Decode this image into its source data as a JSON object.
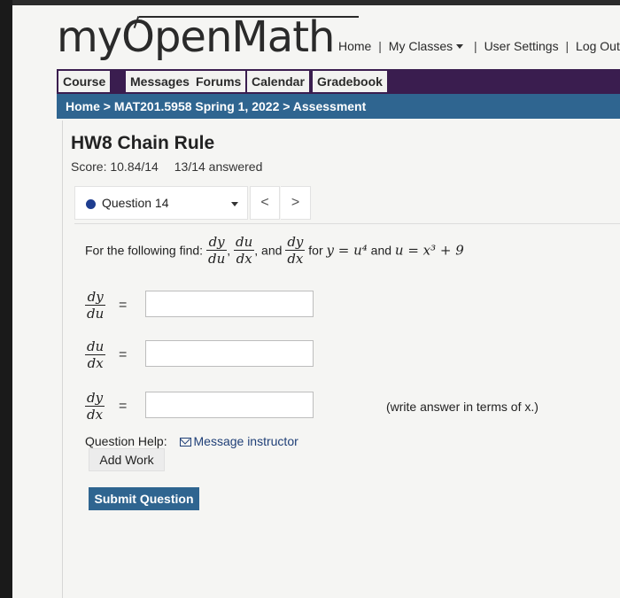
{
  "app": {
    "logo": "myOpenMath"
  },
  "topnav": {
    "home": "Home",
    "my_classes": "My Classes",
    "user_settings": "User Settings",
    "logout": "Log Out",
    "sep": "|"
  },
  "menubar": {
    "items": [
      "Course",
      "Messages",
      "Forums",
      "Calendar",
      "Gradebook"
    ]
  },
  "breadcrumb": {
    "text": "Home > MAT201.5958 Spring 1, 2022 > Assessment"
  },
  "assessment": {
    "title": "HW8 Chain Rule",
    "score": "Score: 10.84/14",
    "answered": "13/14 answered"
  },
  "question_nav": {
    "selected": "Question 14",
    "prev": "<",
    "next": ">"
  },
  "question": {
    "prompt_prefix": "For the following find:",
    "frac1_num": "dy",
    "frac1_den": "du",
    "comma": ",",
    "frac2_num": "du",
    "frac2_den": "dx",
    "and": ", and",
    "frac3_num": "dy",
    "frac3_den": "dx",
    "for_text": "for",
    "eq1": "y = u⁴",
    "and2": "and",
    "eq2": "u = x³ + 9",
    "answers": [
      {
        "num": "dy",
        "den": "du",
        "eq": "=",
        "value": "",
        "hint": ""
      },
      {
        "num": "du",
        "den": "dx",
        "eq": "=",
        "value": "",
        "hint": ""
      },
      {
        "num": "dy",
        "den": "dx",
        "eq": "=",
        "value": "",
        "hint": "(write answer in terms of x.)"
      }
    ]
  },
  "help": {
    "label": "Question Help:",
    "message_link": "Message instructor",
    "add_work": "Add Work",
    "submit": "Submit Question"
  }
}
